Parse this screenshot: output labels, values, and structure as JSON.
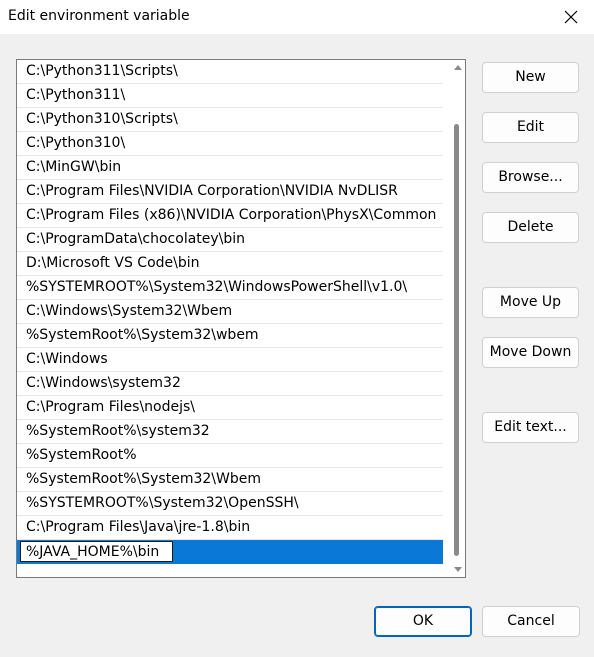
{
  "window": {
    "title": "Edit environment variable",
    "close_icon": "close-icon"
  },
  "list": {
    "items": [
      "C:\\Python311\\Scripts\\",
      "C:\\Python311\\",
      "C:\\Python310\\Scripts\\",
      "C:\\Python310\\",
      "C:\\MinGW\\bin",
      "C:\\Program Files\\NVIDIA Corporation\\NVIDIA NvDLISR",
      "C:\\Program Files (x86)\\NVIDIA Corporation\\PhysX\\Common",
      "C:\\ProgramData\\chocolatey\\bin",
      "D:\\Microsoft VS Code\\bin",
      "%SYSTEMROOT%\\System32\\WindowsPowerShell\\v1.0\\",
      "C:\\Windows\\System32\\Wbem",
      "%SystemRoot%\\System32\\wbem",
      "C:\\Windows",
      "C:\\Windows\\system32",
      "C:\\Program Files\\nodejs\\",
      "%SystemRoot%\\system32",
      "%SystemRoot%",
      "%SystemRoot%\\System32\\Wbem",
      "%SYSTEMROOT%\\System32\\OpenSSH\\",
      "C:\\Program Files\\Java\\jre-1.8\\bin"
    ],
    "editing_value": "%JAVA_HOME%\\bin"
  },
  "buttons": {
    "new": "New",
    "edit": "Edit",
    "browse": "Browse...",
    "delete": "Delete",
    "move_up": "Move Up",
    "move_down": "Move Down",
    "edit_text": "Edit text...",
    "ok": "OK",
    "cancel": "Cancel"
  },
  "colors": {
    "selection": "#0a78d7",
    "accent_border": "#0067c0",
    "titlebar": "#ffffff",
    "dialog_bg": "#f0f0f0"
  }
}
